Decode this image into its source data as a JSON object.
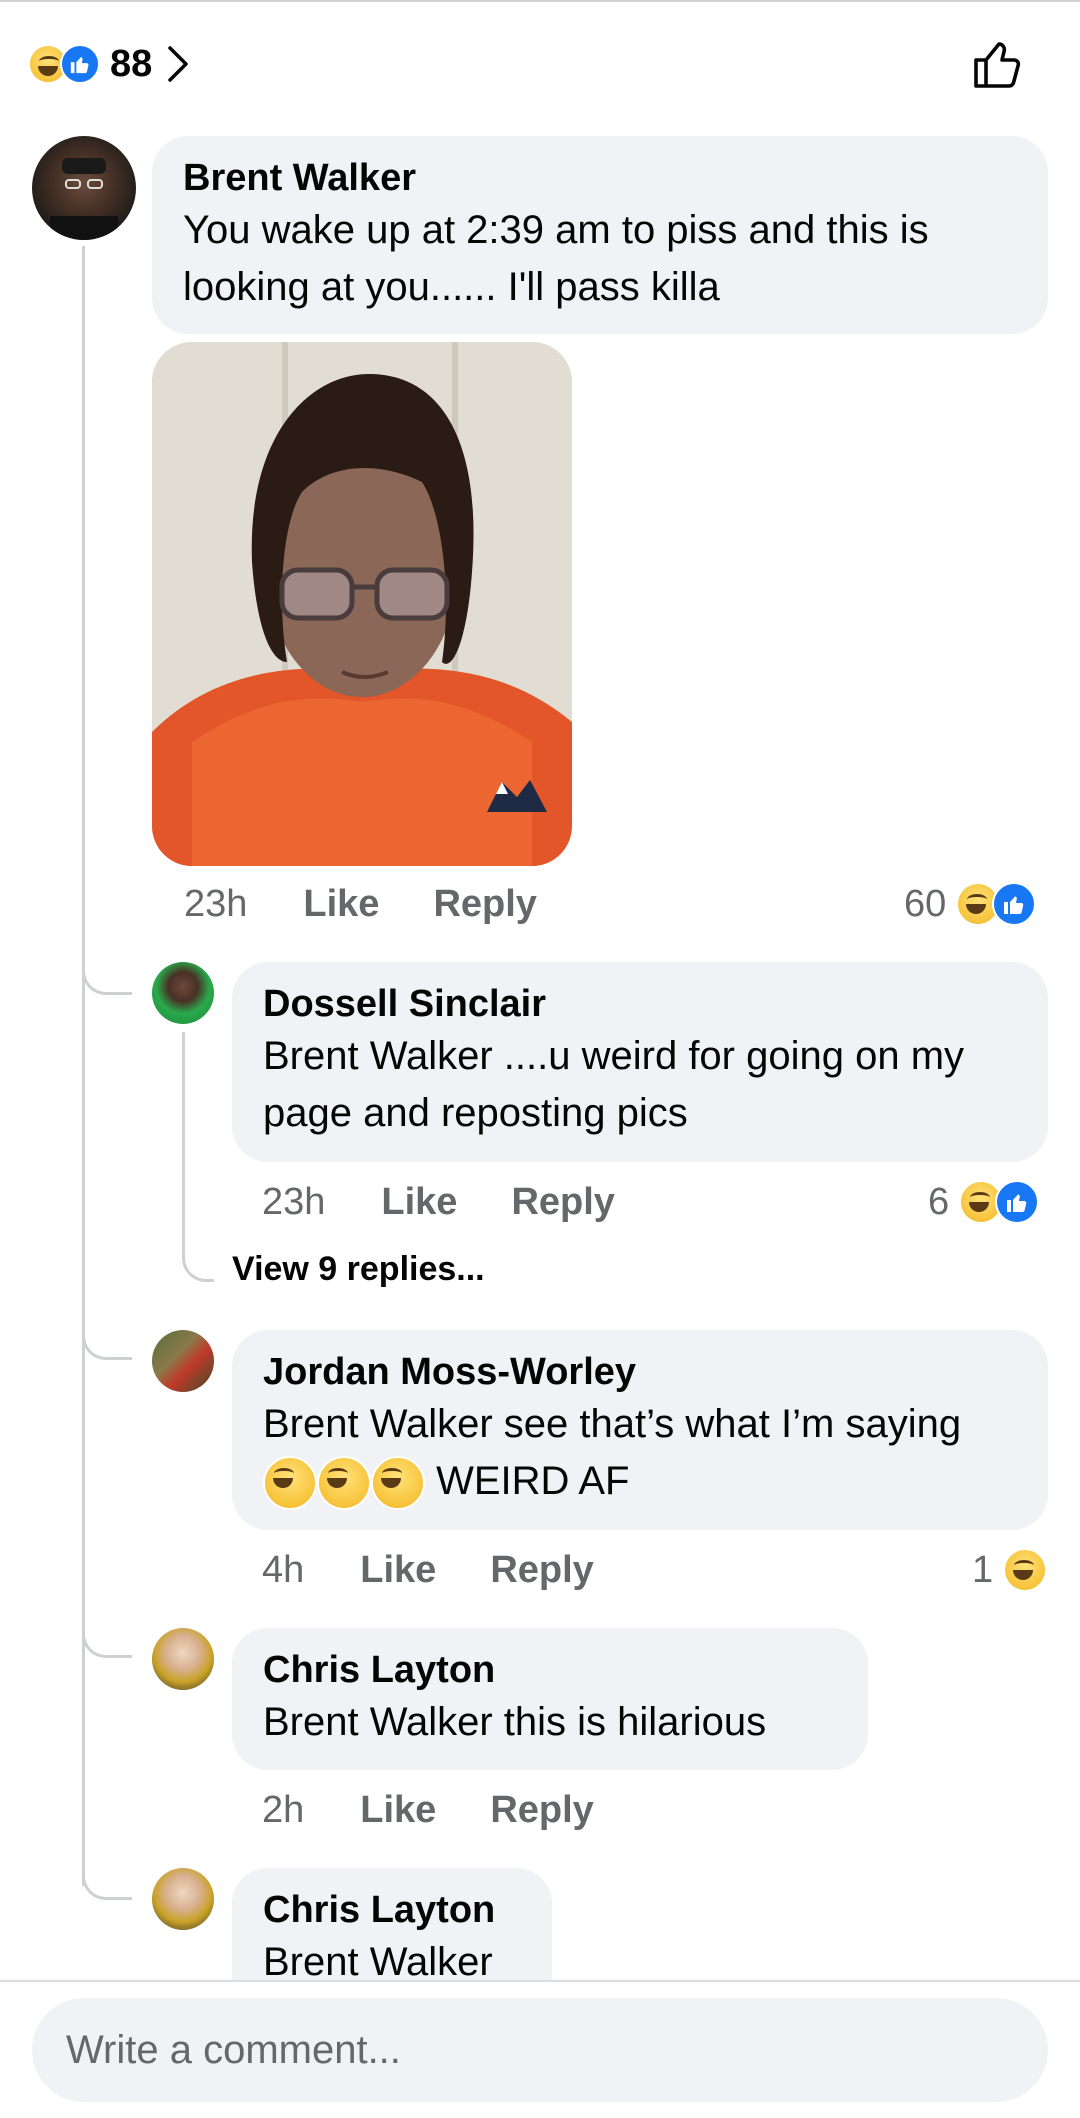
{
  "summary": {
    "count": "88",
    "reactions": [
      "haha-icon",
      "like-icon"
    ]
  },
  "comments": [
    {
      "author": "Brent Walker",
      "text": "You wake up at 2:39 am to piss and this is looking at you...... I'll pass killa",
      "time": "23h",
      "like_label": "Like",
      "reply_label": "Reply",
      "reaction_count": "60"
    },
    {
      "author": "Dossell Sinclair",
      "text": "Brent Walker ....u weird for going on my page and reposting pics",
      "time": "23h",
      "like_label": "Like",
      "reply_label": "Reply",
      "reaction_count": "6",
      "view_replies": "View 9 replies..."
    },
    {
      "author": "Jordan Moss-Worley",
      "text_before": "Brent Walker see that’s what I’m saying",
      "text_after": "WEIRD AF",
      "time": "4h",
      "like_label": "Like",
      "reply_label": "Reply",
      "reaction_count": "1"
    },
    {
      "author": "Chris Layton",
      "text": "Brent Walker this is hilarious",
      "time": "2h",
      "like_label": "Like",
      "reply_label": "Reply"
    },
    {
      "author": "Chris Layton",
      "text": "Brent Walker"
    }
  ],
  "composer": {
    "placeholder": "Write a comment..."
  },
  "colors": {
    "bubble": "#f0f2f5",
    "meta_text": "#65676b",
    "like_blue": "#1877f2",
    "haha_yellow": "#f7c33a"
  }
}
